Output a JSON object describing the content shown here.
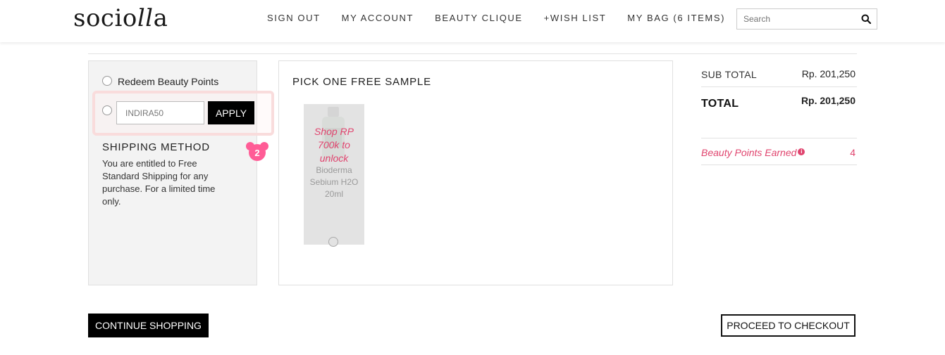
{
  "header": {
    "logo_main": "socio",
    "logo_italic": "ll",
    "logo_tail": "a",
    "nav": [
      "SIGN OUT",
      "MY ACCOUNT",
      "BEAUTY CLIQUE",
      "+WISH LIST",
      "MY BAG (6 ITEMS)"
    ],
    "search_placeholder": "Search",
    "search_icon": "search-icon"
  },
  "left_panel": {
    "redeem_label": "Redeem Beauty Points",
    "promo_value": "INDIRA50",
    "apply_label": "APPLY",
    "badge_number": "2",
    "shipping_title": "SHIPPING METHOD",
    "shipping_text": "You are entitled to Free Standard Shipping for any purchase. For a limited time only."
  },
  "sample": {
    "title": "PICK ONE FREE SAMPLE",
    "items": [
      {
        "unlock_text": "Shop RP 700k to unlock",
        "name": "Bioderma Sebium H2O 20ml"
      }
    ]
  },
  "summary": {
    "subtotal_label": "SUB TOTAL",
    "subtotal_value": "Rp. 201,250",
    "total_label": "TOTAL",
    "total_value": "Rp. 201,250",
    "points_label": "Beauty Points Earned",
    "points_value": "4",
    "info_icon": "info-icon"
  },
  "footer": {
    "continue_label": "CONTINUE SHOPPING",
    "checkout_label": "PROCEED TO CHECKOUT"
  },
  "colors": {
    "accent_pink": "#e0446e",
    "button_black": "#000000",
    "panel_gray": "#f3f3f3"
  }
}
